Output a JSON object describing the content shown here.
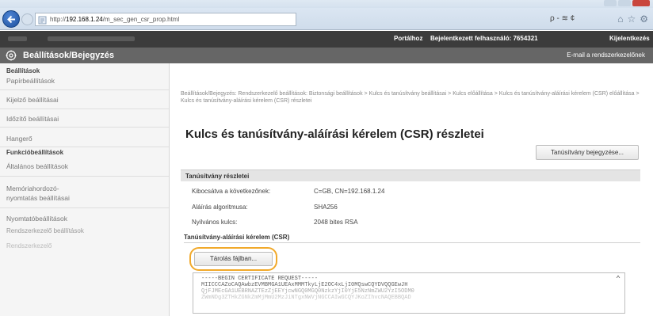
{
  "browser": {
    "url_prefix": "http://",
    "url_host": "192.168.1.24",
    "url_path": "/m_sec_gen_csr_prop.html",
    "url_controls": "ρ - ≋ ¢"
  },
  "topbar": {
    "portal": "Portálhoz",
    "user": "Bejelentkezett felhasználó: 7654321",
    "logout": "Kijelentkezés"
  },
  "header": {
    "title": "Beállítások/Bejegyzés",
    "mail": "E-mail a rendszerkezelőnek"
  },
  "sidebar": {
    "section1": "Beállítások",
    "items1": [
      "Papírbeállítások",
      "Kijelző beállításai",
      "Időzítő beállításai",
      "Hangerő"
    ],
    "section2": "Funkcióbeállítások",
    "items2": [
      "Általános beállítások",
      "Memóriahordozó-nyomtatás beállításai",
      "Nyomtatóbeállítások"
    ],
    "section3": "Rendszerkezelő beállítások",
    "item_cut": "Rendszerkezelő"
  },
  "main": {
    "breadcrumb": "Beállítások/Bejegyzés: Rendszerkezelő beállítások: Biztonsági beállítások > Kulcs és tanúsítvány beállításai > Kulcs előállítása > Kulcs és tanúsítvány-aláírási kérelem (CSR) előállítása > Kulcs és tanúsítvány-aláírási kérelem (CSR) részletei",
    "title": "Kulcs és tanúsítvány-aláírási kérelem (CSR) részletei",
    "cert_button": "Tanúsítvány bejegyzése...",
    "section_title": "Tanúsítvány részletei",
    "fields": [
      {
        "label": "Kibocsátva a következőnek:",
        "value": "C=GB, CN=192.168.1.24"
      },
      {
        "label": "Aláírás algoritmusa:",
        "value": "SHA256"
      },
      {
        "label": "Nyilvános kulcs:",
        "value": "2048 bites RSA"
      }
    ],
    "csr_label": "Tanúsítvány-aláírási kérelem (CSR)",
    "save_button": "Tárolás fájlban...",
    "csr_lines": [
      "-----BEGIN CERTIFICATE REQUEST-----",
      "MIICCCAZoCAQAwbzEVMBMGA1UEAxMMMTkyLjE2OC4xLjI0MQswCQYDVQQGEwJH",
      "QjFJMEcGA1UEBRNAZTEzZjEEYjcwNGQ0MGQ0NzkzYjI0YjE5NzNmZWU2YzI5ODM0",
      "ZWmNDg3ZTHkZGNkZmMjMmU2MzJiNTgxNWVjNGCCAIwGCQYJKoZIhvcNAQEBBQAD"
    ]
  },
  "colors": {
    "topbar": "#3c3c3c",
    "header": "#666666",
    "highlight": "#f1a92a"
  }
}
